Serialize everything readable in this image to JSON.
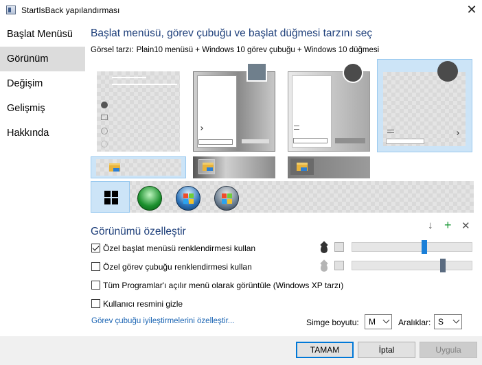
{
  "window": {
    "title": "StartIsBack yapılandırması",
    "close_glyph": "✕",
    "app_icon": "startisback-icon"
  },
  "sidebar": {
    "items": [
      {
        "label": "Başlat Menüsü",
        "active": false
      },
      {
        "label": "Görünüm",
        "active": true
      },
      {
        "label": "Değişim",
        "active": false
      },
      {
        "label": "Gelişmiş",
        "active": false
      },
      {
        "label": "Hakkında",
        "active": false
      }
    ]
  },
  "main": {
    "section_title": "Başlat menüsü, görev çubuğu ve başlat düğmesi tarzını seç",
    "visual_style_label": "Görsel tarzı:",
    "visual_style_value": "Plain10 menüsü + Windows 10 görev çubuğu + Windows 10 düğmesi",
    "start_menu_styles": [
      "plain10",
      "windows7-frosted",
      "windows7-grey",
      "windows10"
    ],
    "selected_menu_style": 3,
    "taskbar_styles": [
      "plain10",
      "windows7-glass",
      "windows10-dark"
    ],
    "selected_taskbar_style": 0,
    "start_buttons": [
      "windows10-logo-icon",
      "clover-orb-icon",
      "windows7-orb-icon",
      "windows-vista-orb-icon"
    ],
    "selected_start_button": 0
  },
  "customize": {
    "title": "Görünümü özelleştir",
    "tools": {
      "download": "↓",
      "add": "+",
      "remove": "✕"
    },
    "options": [
      {
        "label": "Özel başlat menüsü renklendirmesi kullan",
        "checked": true
      },
      {
        "label": "Özel görev çubuğu renklendirmesi kullan",
        "checked": false
      },
      {
        "label": "Tüm Programlar'ı açılır menü olarak görüntüle (Windows XP tarzı)",
        "checked": false
      },
      {
        "label": "Kullanıcı resmini gizle",
        "checked": false
      }
    ],
    "sliders": [
      {
        "name": "start-menu-transparency",
        "value": 0.61,
        "color": "#1a7fd8"
      },
      {
        "name": "taskbar-transparency",
        "value": 0.77,
        "color": "#5a6b80"
      }
    ],
    "link": "Görev çubuğu iyileştirmelerini özelleştir...",
    "icon_size_label": "Simge boyutu:",
    "icon_size_value": "M",
    "spacing_label": "Aralıklar:",
    "spacing_value": "S"
  },
  "footer": {
    "ok": "TAMAM",
    "cancel": "İptal",
    "apply": "Uygula"
  },
  "colors": {
    "accent": "#1e3f7a",
    "link": "#1a64b3",
    "selection": "#cce4f7",
    "focus": "#0078d7"
  }
}
